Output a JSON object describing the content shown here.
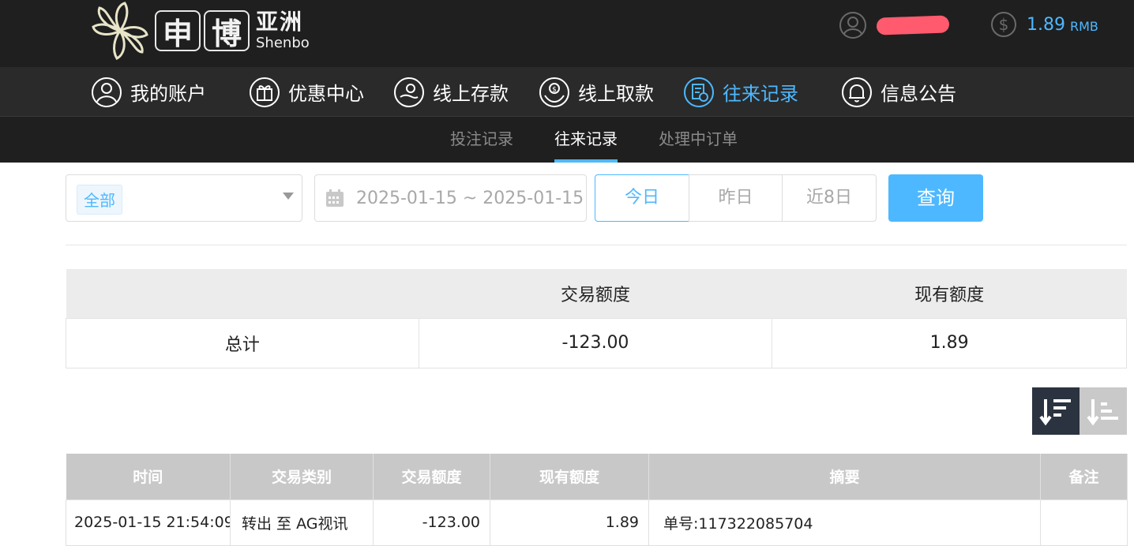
{
  "header": {
    "logo_cn_box1": "申",
    "logo_cn_box2": "博",
    "logo_cn_text": "亚洲",
    "logo_en_text": "Shenbo",
    "balance_value": "1.89",
    "balance_currency": "RMB",
    "accent_color": "#4db8ff"
  },
  "main_nav": [
    {
      "label": "我的账户",
      "icon": "user-circle-icon"
    },
    {
      "label": "优惠中心",
      "icon": "gift-icon"
    },
    {
      "label": "线上存款",
      "icon": "deposit-icon"
    },
    {
      "label": "线上取款",
      "icon": "withdraw-icon"
    },
    {
      "label": "往来记录",
      "icon": "records-icon",
      "active": true
    },
    {
      "label": "信息公告",
      "icon": "bell-icon"
    }
  ],
  "sub_nav": [
    {
      "label": "投注记录"
    },
    {
      "label": "往来记录",
      "active": true
    },
    {
      "label": "处理中订单"
    }
  ],
  "filter": {
    "type_selected": "全部",
    "date_range": "2025-01-15 ~ 2025-01-15",
    "quick_today": "今日",
    "quick_yesterday": "昨日",
    "quick_8days": "近8日",
    "query_label": "查询"
  },
  "summary": {
    "headers": [
      "",
      "交易额度",
      "现有额度"
    ],
    "row_label": "总计",
    "trade_amount": "-123.00",
    "current_amount": "1.89"
  },
  "records": {
    "headers": [
      "时间",
      "交易类别",
      "交易额度",
      "现有额度",
      "摘要",
      "备注"
    ],
    "rows": [
      [
        "2025-01-15 21:54:09",
        "转出 至 AG视讯",
        "-123.00",
        "1.89",
        "单号:117322085704",
        ""
      ]
    ]
  }
}
